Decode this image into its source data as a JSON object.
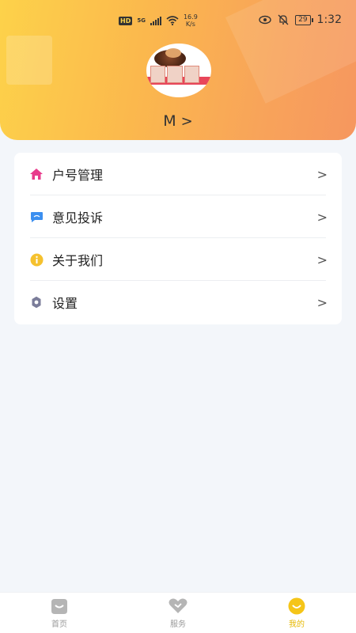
{
  "status_bar": {
    "hd": "HD",
    "network": "5G",
    "speed_value": "16.9",
    "speed_unit": "K/s",
    "battery": "29",
    "time": "1:32"
  },
  "profile": {
    "username": "M",
    "chevron": ">"
  },
  "menu": [
    {
      "label": "户号管理",
      "icon": "home-icon",
      "arrow": ">"
    },
    {
      "label": "意见投诉",
      "icon": "chat-icon",
      "arrow": ">"
    },
    {
      "label": "关于我们",
      "icon": "info-icon",
      "arrow": ">"
    },
    {
      "label": "设置",
      "icon": "gear-icon",
      "arrow": ">"
    }
  ],
  "tabs": [
    {
      "label": "首页",
      "icon": "home-tab-icon",
      "active": false
    },
    {
      "label": "服务",
      "icon": "heart-icon",
      "active": false
    },
    {
      "label": "我的",
      "icon": "smile-icon",
      "active": true
    }
  ],
  "colors": {
    "header_gradient_start": "#fdd24a",
    "header_gradient_end": "#f6975f",
    "home_icon": "#e83a8c",
    "chat_icon": "#3b8ff0",
    "info_icon": "#f5c12e",
    "gear_icon": "#7b7d9a",
    "active_tab": "#e6b800"
  }
}
